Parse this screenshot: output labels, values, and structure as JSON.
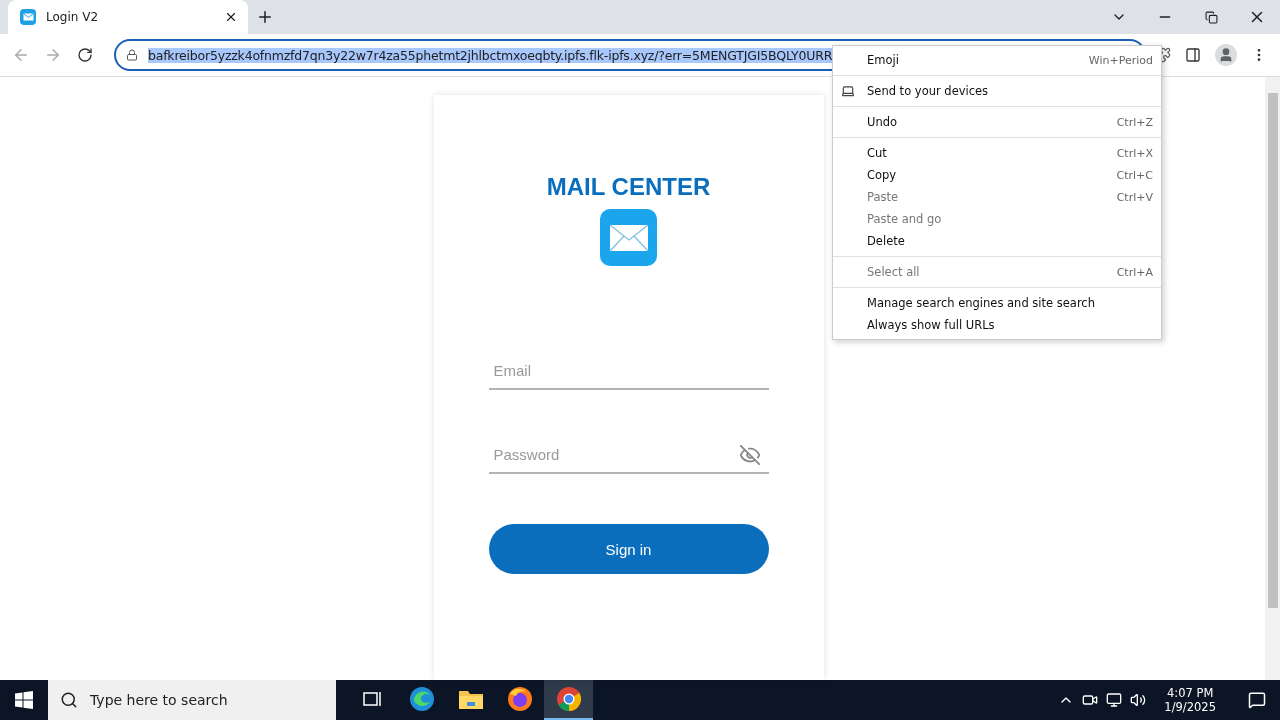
{
  "browser": {
    "tab": {
      "title": "Login V2",
      "selected": true
    },
    "address": {
      "url": "bafkreibor5yzzk4ofnmzfd7qn3y22w7r4za55phetmt2jhlbctmxoeqbty.ipfs.flk-ipfs.xyz/?err=5MENGTJGI5BQLY0URR",
      "selected": true
    }
  },
  "page": {
    "title": "MAIL CENTER",
    "fields": [
      {
        "kind": "text",
        "placeholder": "Email"
      },
      {
        "kind": "password",
        "placeholder": "Password"
      }
    ],
    "button": "Sign in"
  },
  "context_menu": {
    "groups": [
      [
        {
          "kind": "plain",
          "label": "Emoji",
          "shortcut": "Win+Period",
          "disabled": false
        }
      ],
      [
        {
          "kind": "device",
          "label": "Send to your devices",
          "disabled": false
        }
      ],
      [
        {
          "kind": "plain",
          "label": "Undo",
          "shortcut": "Ctrl+Z",
          "disabled": false
        }
      ],
      [
        {
          "kind": "plain",
          "label": "Cut",
          "shortcut": "Ctrl+X",
          "disabled": false
        },
        {
          "kind": "plain",
          "label": "Copy",
          "shortcut": "Ctrl+C",
          "disabled": false
        },
        {
          "kind": "plain",
          "label": "Paste",
          "shortcut": "Ctrl+V",
          "disabled": true
        },
        {
          "kind": "plain",
          "label": "Paste and go",
          "disabled": true
        },
        {
          "kind": "plain",
          "label": "Delete",
          "disabled": false
        }
      ],
      [
        {
          "kind": "plain",
          "label": "Select all",
          "shortcut": "Ctrl+A",
          "disabled": true
        }
      ],
      [
        {
          "kind": "plain",
          "label": "Manage search engines and site search",
          "disabled": false
        },
        {
          "kind": "plain",
          "label": "Always show full URLs",
          "disabled": false
        }
      ]
    ]
  },
  "taskbar": {
    "search_placeholder": "Type here to search",
    "time": "4:07 PM",
    "date": "1/9/2025",
    "apps": [
      {
        "kind": "taskview",
        "selected": false
      },
      {
        "kind": "edge",
        "selected": false
      },
      {
        "kind": "explorer",
        "selected": false
      },
      {
        "kind": "firefox",
        "selected": false
      },
      {
        "kind": "chrome",
        "selected": true
      }
    ]
  }
}
